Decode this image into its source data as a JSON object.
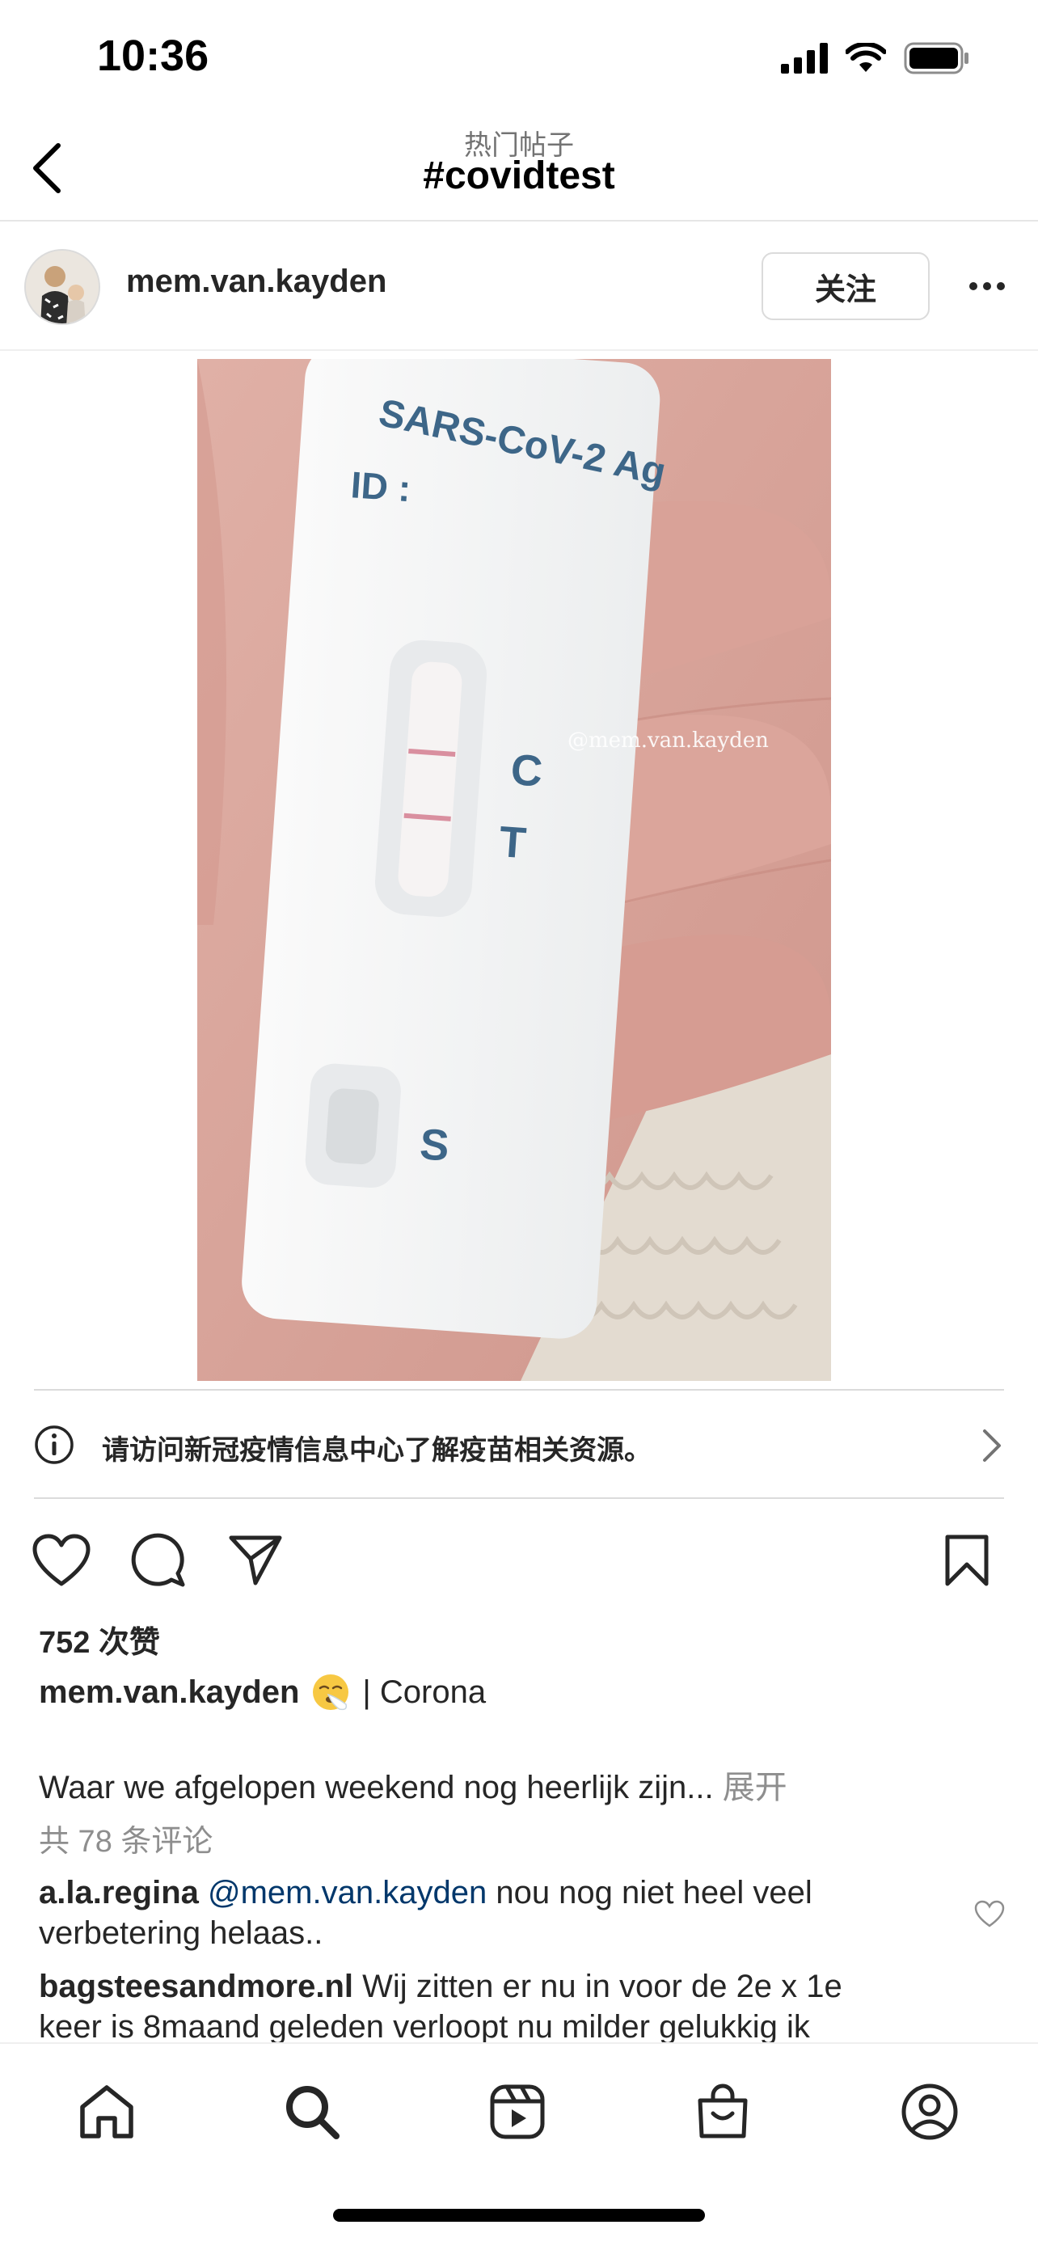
{
  "status_bar": {
    "time": "10:36"
  },
  "header": {
    "subtitle": "热门帖子",
    "title": "#covidtest"
  },
  "post": {
    "username": "mem.van.kayden",
    "follow_label": "关注",
    "image": {
      "test_brand": "SARS-CoV-2 Ag",
      "id_label": "ID :",
      "marker_c": "C",
      "marker_t": "T",
      "marker_s": "S",
      "watermark": "@mem.van.kayden"
    },
    "info_banner": "请访问新冠疫情信息中心了解疫苗相关资源。",
    "likes": "752 次赞",
    "caption": {
      "username": "mem.van.kayden",
      "suffix": "| Corona",
      "text": "Waar we afgelopen weekend nog heerlijk zijn...",
      "expand_label": "展开"
    },
    "comments_count": "共 78 条评论",
    "comments": [
      {
        "username": "a.la.regina",
        "mention": "@mem.van.kayden",
        "text_line1": "nou nog niet heel veel",
        "text_line2": "verbetering helaas.."
      },
      {
        "username": "bagsteesandmore.nl",
        "text_line1": "Wij zitten er nu in voor de 2e x 1e",
        "text_line2": "keer is 8maand geleden  verloopt nu milder gelukkig ik"
      }
    ]
  },
  "icons": {
    "back": "chevron-left-icon",
    "more": "ellipsis-icon",
    "info": "info-circle-icon",
    "chevron": "chevron-right-icon",
    "like": "heart-icon",
    "comment": "comment-bubble-icon",
    "share": "paper-plane-icon",
    "save": "bookmark-icon",
    "tabs": [
      "home-icon",
      "search-icon",
      "reels-icon",
      "shop-icon",
      "profile-icon"
    ]
  },
  "colors": {
    "text": "#262626",
    "secondary": "#8e8e8e",
    "mention": "#00376b",
    "divider": "#dbdbdb"
  }
}
